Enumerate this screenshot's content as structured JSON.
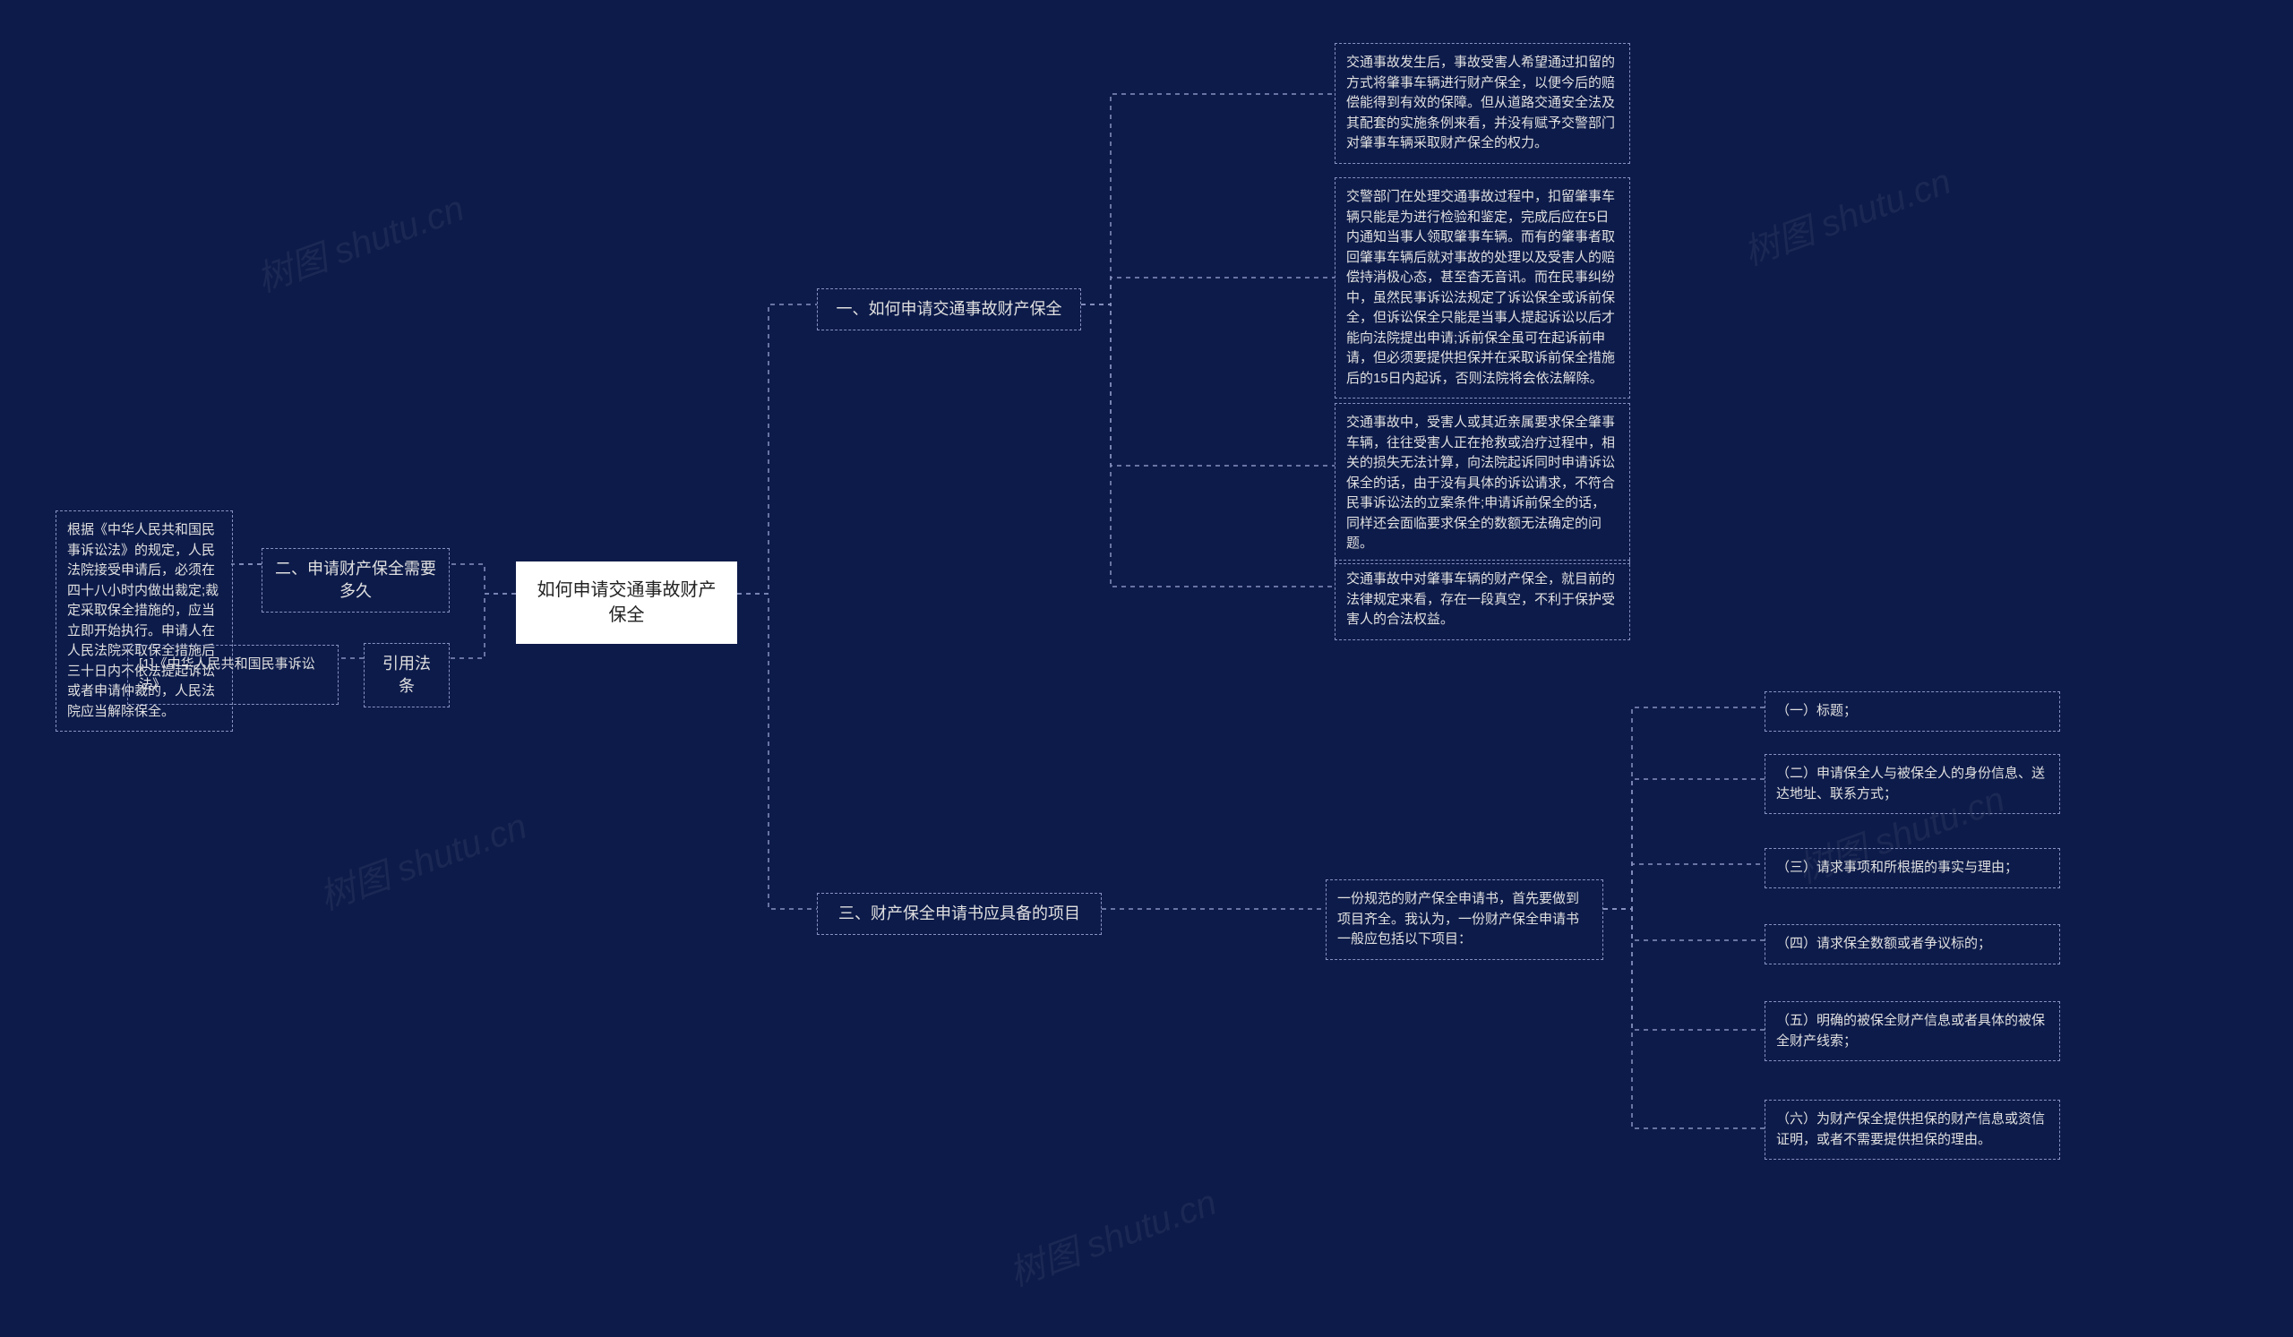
{
  "root": "如何申请交通事故财产保全",
  "b1": {
    "label": "一、如何申请交通事故财产保全",
    "leaves": [
      "交通事故发生后，事故受害人希望通过扣留的方式将肇事车辆进行财产保全，以便今后的赔偿能得到有效的保障。但从道路交通安全法及其配套的实施条例来看，并没有赋予交警部门对肇事车辆采取财产保全的权力。",
      "交警部门在处理交通事故过程中，扣留肇事车辆只能是为进行检验和鉴定，完成后应在5日内通知当事人领取肇事车辆。而有的肇事者取回肇事车辆后就对事故的处理以及受害人的赔偿持消极心态，甚至杳无音讯。而在民事纠纷中，虽然民事诉讼法规定了诉讼保全或诉前保全，但诉讼保全只能是当事人提起诉讼以后才能向法院提出申请;诉前保全虽可在起诉前申请，但必须要提供担保并在采取诉前保全措施后的15日内起诉，否则法院将会依法解除。",
      "交通事故中，受害人或其近亲属要求保全肇事车辆，往往受害人正在抢救或治疗过程中，相关的损失无法计算，向法院起诉同时申请诉讼保全的话，由于没有具体的诉讼请求，不符合民事诉讼法的立案条件;申请诉前保全的话，同样还会面临要求保全的数额无法确定的问题。",
      "交通事故中对肇事车辆的财产保全，就目前的法律规定来看，存在一段真空，不利于保护受害人的合法权益。"
    ]
  },
  "b2": {
    "label": "二、申请财产保全需要多久",
    "leaf": "根据《中华人民共和国民事诉讼法》的规定，人民法院接受申请后，必须在四十八小时内做出裁定;裁定采取保全措施的，应当立即开始执行。申请人在人民法院采取保全措施后三十日内不依法提起诉讼或者申请仲裁的，人民法院应当解除保全。"
  },
  "b3": {
    "label": "三、财产保全申请书应具备的项目",
    "intro": "一份规范的财产保全申请书，首先要做到项目齐全。我认为，一份财产保全申请书一般应包括以下项目：",
    "items": [
      "（一）标题；",
      "（二）申请保全人与被保全人的身份信息、送达地址、联系方式；",
      "（三）请求事项和所根据的事实与理由；",
      "（四）请求保全数额或者争议标的；",
      "（五）明确的被保全财产信息或者具体的被保全财产线索；",
      "（六）为财产保全提供担保的财产信息或资信证明，或者不需要提供担保的理由。"
    ]
  },
  "b4": {
    "label": "引用法条",
    "leaf": "[1]《中华人民共和国民事诉讼法》"
  },
  "watermark": "树图 shutu.cn"
}
